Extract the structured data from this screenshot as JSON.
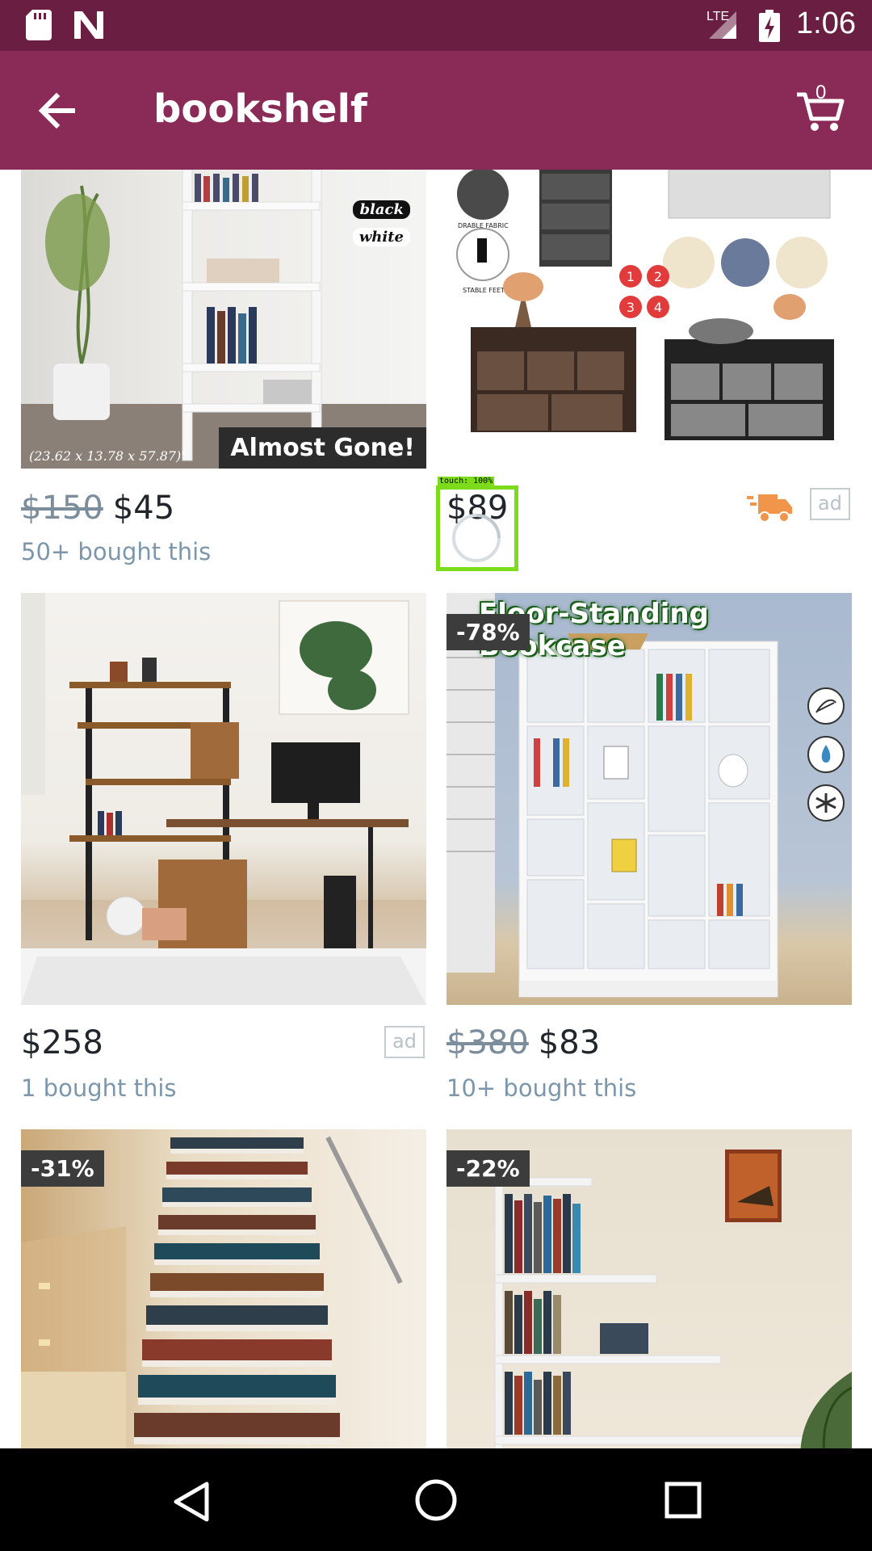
{
  "status_bar": {
    "time": "1:06",
    "network": "LTE",
    "icons": [
      "sd-card-icon",
      "n-logo-icon",
      "signal-icon",
      "battery-charging-icon"
    ]
  },
  "app_bar": {
    "title": "bookshelf",
    "cart_count": "0",
    "back_icon": "arrow-left-icon",
    "cart_icon": "shopping-cart-icon"
  },
  "products": [
    {
      "old_price": "$150",
      "price": "$45",
      "bought": "50+ bought this",
      "overlay_badge": "Almost Gone!",
      "image_text": "(23.62 x 13.78 x 57.87)\"",
      "color_tags": [
        "black",
        "white"
      ]
    },
    {
      "old_price": "",
      "price": "$89",
      "ad": "ad",
      "shipping_icon": "truck-icon",
      "image_labels": [
        "DRABLE FABRIC",
        "STABLE FEET"
      ],
      "image_numbers": [
        "1",
        "2",
        "3",
        "4"
      ]
    },
    {
      "old_price": "",
      "price": "$258",
      "bought": "1 bought this",
      "ad": "ad"
    },
    {
      "old_price": "$380",
      "price": "$83",
      "bought": "10+ bought this",
      "discount": "-78%",
      "image_banner": "Floor-Standing Bookcase"
    },
    {
      "discount": "-31%"
    },
    {
      "discount": "-22%"
    }
  ],
  "touch_overlay": {
    "label": "touch: 100%"
  },
  "nav_bar": {
    "icons": [
      "back-triangle-icon",
      "home-circle-icon",
      "recents-square-icon"
    ]
  },
  "colors": {
    "status_bar": "#6a1f42",
    "app_bar": "#8a2a56",
    "price": "#20262b",
    "muted": "#7c97ab",
    "touch": "#7cdc1a"
  }
}
